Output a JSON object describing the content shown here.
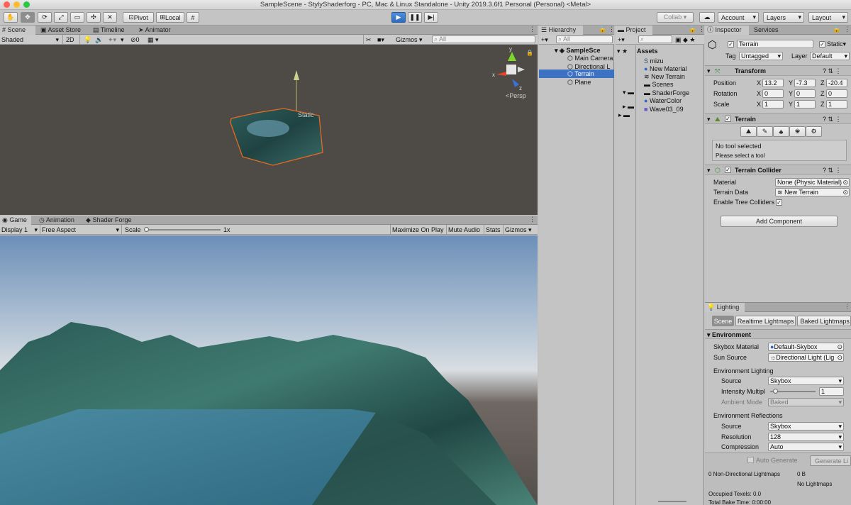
{
  "window": {
    "title": "SampleScene - StylyShaderforg - PC, Mac & Linux Standalone - Unity 2019.3.6f1 Personal (Personal) <Metal>"
  },
  "toolbar": {
    "pivot": "Pivot",
    "local": "Local",
    "collab": "Collab ▾",
    "account": "Account",
    "layers": "Layers",
    "layout": "Layout"
  },
  "scene": {
    "tabs": [
      "Scene",
      "Asset Store",
      "Timeline",
      "Animator"
    ],
    "shading": "Shaded",
    "mode2d": "2D",
    "hidden_count": "0",
    "gizmos": "Gizmos",
    "search_placeholder": "All",
    "persp": "Persp",
    "static_label": "Static",
    "axis_x": "x",
    "axis_y": "y",
    "axis_z": "z"
  },
  "game": {
    "tabs": [
      "Game",
      "Animation",
      "Shader Forge"
    ],
    "display": "Display 1",
    "aspect": "Free Aspect",
    "scale_label": "Scale",
    "scale_value": "1x",
    "maximize": "Maximize On Play",
    "mute": "Mute Audio",
    "stats": "Stats",
    "gizmos": "Gizmos"
  },
  "hierarchy": {
    "title": "Hierarchy",
    "search_placeholder": "All",
    "scene": "SampleSce",
    "items": [
      "Main Camera",
      "Directional L",
      "Terrain",
      "Plane"
    ],
    "selected_index": 2
  },
  "project": {
    "title": "Project",
    "root": "Assets",
    "items": [
      "mizu",
      "New Material",
      "New Terrain",
      "Scenes",
      "ShaderForge",
      "WaterColor",
      "Wave03_09"
    ]
  },
  "inspector": {
    "tabs": [
      "Inspector",
      "Services"
    ],
    "object_name": "Terrain",
    "static_label": "Static",
    "tag_label": "Tag",
    "tag_value": "Untagged",
    "layer_label": "Layer",
    "layer_value": "Default",
    "transform": {
      "title": "Transform",
      "rows": [
        {
          "label": "Position",
          "x": "13.2",
          "y": "-7.3",
          "z": "-20.4"
        },
        {
          "label": "Rotation",
          "x": "0",
          "y": "0",
          "z": "0"
        },
        {
          "label": "Scale",
          "x": "1",
          "y": "1",
          "z": "1"
        }
      ],
      "axes": [
        "X",
        "Y",
        "Z"
      ]
    },
    "terrain": {
      "title": "Terrain",
      "message": "No tool selected",
      "hint": "Please select a tool"
    },
    "collider": {
      "title": "Terrain Collider",
      "material_label": "Material",
      "material_value": "None (Physic Material)",
      "data_label": "Terrain Data",
      "data_value": "New Terrain",
      "trees_label": "Enable Tree Colliders"
    },
    "add_component": "Add Component"
  },
  "lighting": {
    "title": "Lighting",
    "tabs": [
      "Scene",
      "Realtime Lightmaps",
      "Baked Lightmaps"
    ],
    "environment": "Environment",
    "skybox_label": "Skybox Material",
    "skybox_value": "Default-Skybox",
    "sun_label": "Sun Source",
    "sun_value": "Directional Light (Lig",
    "env_lighting": "Environment Lighting",
    "source_label": "Source",
    "source_value": "Skybox",
    "intensity_label": "Intensity Multipl",
    "intensity_value": "1",
    "ambient_label": "Ambient Mode",
    "ambient_value": "Baked",
    "env_reflections": "Environment Reflections",
    "refl_source_label": "Source",
    "refl_source_value": "Skybox",
    "resolution_label": "Resolution",
    "resolution_value": "128",
    "compression_label": "Compression",
    "compression_value": "Auto",
    "auto_generate": "Auto Generate",
    "generate": "Generate Li",
    "stat1": "0 Non-Directional Lightmaps",
    "stat1_value": "0 B",
    "stat2": "No Lightmaps",
    "stat3": "Occupied Texels: 0.0",
    "stat4": "Total Bake Time: 0:00:00"
  },
  "colors": {
    "accent": "#3e6db5",
    "selection": "#3d72c3",
    "terrain": "#2f5f5a",
    "water": "#3f7f96"
  }
}
